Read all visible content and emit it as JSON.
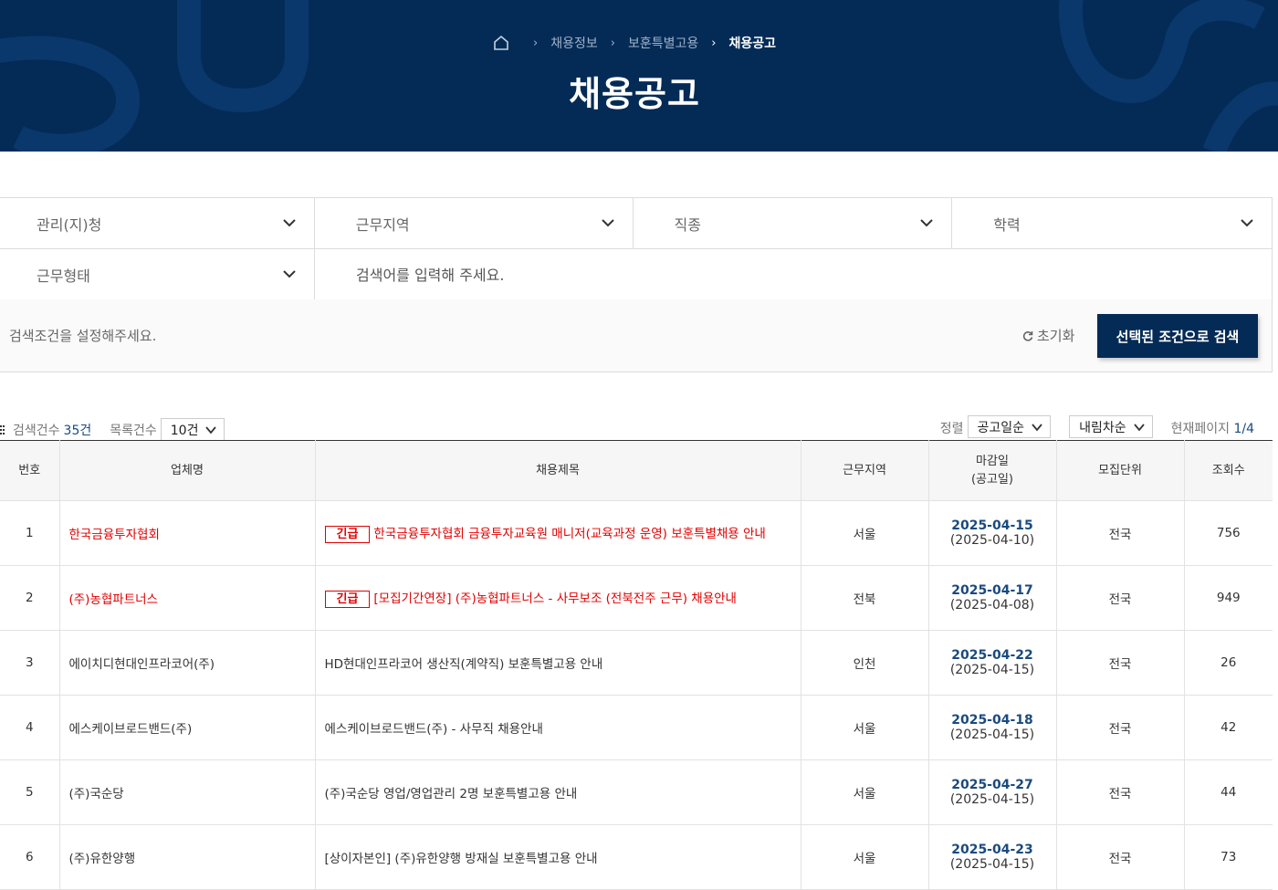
{
  "breadcrumb": {
    "home_icon": "home-icon",
    "items": [
      "채용정보",
      "보훈특별고용"
    ],
    "current": "채용공고"
  },
  "page_title": "채용공고",
  "filters": {
    "agency": "관리(지)청",
    "region": "근무지역",
    "job": "직종",
    "education": "학력",
    "work_type": "근무형태",
    "search_placeholder": "검색어를 입력해 주세요."
  },
  "conditions": {
    "message": "검색조건을 설정해주세요.",
    "reset_label": "초기화",
    "search_button": "선택된 조건으로 검색"
  },
  "toolbar": {
    "result_label": "검색건수",
    "result_count": "35건",
    "list_count_label": "목록건수",
    "list_count_value": "10건",
    "sort_label": "정렬",
    "sort_value": "공고일순",
    "order_value": "내림차순",
    "page_label": "현재페이지",
    "page_value": "1/4"
  },
  "table": {
    "headers": {
      "no": "번호",
      "company": "업체명",
      "title": "채용제목",
      "region": "근무지역",
      "deadline_line1": "마감일",
      "deadline_line2": "(공고일)",
      "unit": "모집단위",
      "views": "조회수"
    },
    "urgent_badge": "긴급",
    "rows": [
      {
        "no": "1",
        "company": "한국금융투자협회",
        "urgent": true,
        "title": "한국금융투자협회 금융투자교육원 매니저(교육과정 운영) 보훈특별채용 안내",
        "region": "서울",
        "deadline": "2025-04-15",
        "posted": "(2025-04-10)",
        "unit": "전국",
        "views": "756"
      },
      {
        "no": "2",
        "company": "(주)농협파트너스",
        "urgent": true,
        "title": "[모집기간연장] (주)농협파트너스 - 사무보조 (전북전주 근무) 채용안내",
        "region": "전북",
        "deadline": "2025-04-17",
        "posted": "(2025-04-08)",
        "unit": "전국",
        "views": "949"
      },
      {
        "no": "3",
        "company": "에이치디현대인프라코어(주)",
        "urgent": false,
        "title": "HD현대인프라코어 생산직(계약직) 보훈특별고용 안내",
        "region": "인천",
        "deadline": "2025-04-22",
        "posted": "(2025-04-15)",
        "unit": "전국",
        "views": "26"
      },
      {
        "no": "4",
        "company": "에스케이브로드밴드(주)",
        "urgent": false,
        "title": "에스케이브로드밴드(주) - 사무직 채용안내",
        "region": "서울",
        "deadline": "2025-04-18",
        "posted": "(2025-04-15)",
        "unit": "전국",
        "views": "42"
      },
      {
        "no": "5",
        "company": "(주)국순당",
        "urgent": false,
        "title": "(주)국순당 영업/영업관리 2명 보훈특별고용 안내",
        "region": "서울",
        "deadline": "2025-04-27",
        "posted": "(2025-04-15)",
        "unit": "전국",
        "views": "44"
      },
      {
        "no": "6",
        "company": "(주)유한양행",
        "urgent": false,
        "title": "[상이자본인] (주)유한양행 방재실 보훈특별고용 안내",
        "region": "서울",
        "deadline": "2025-04-23",
        "posted": "(2025-04-15)",
        "unit": "전국",
        "views": "73"
      }
    ]
  },
  "colors": {
    "banner": "#042b56",
    "accent": "#1a4a7e",
    "urgent": "#e00000"
  }
}
